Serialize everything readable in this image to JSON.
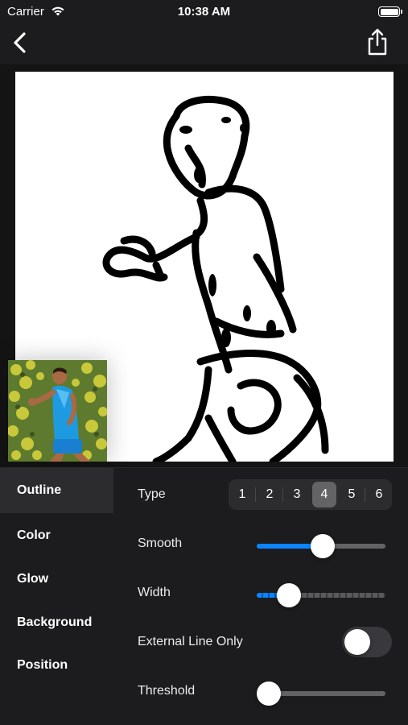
{
  "status_bar": {
    "carrier": "Carrier",
    "time": "10:38 AM"
  },
  "nav": {
    "back_icon": "chevron-left-icon",
    "share_icon": "share-icon"
  },
  "preview": {
    "image": "outline-sketch-of-runner",
    "thumbnail": "original-runner-photo"
  },
  "menu": {
    "items": [
      {
        "label": "Outline",
        "active": true
      },
      {
        "label": "Color",
        "active": false
      },
      {
        "label": "Glow",
        "active": false
      },
      {
        "label": "Background",
        "active": false
      },
      {
        "label": "Position",
        "active": false
      }
    ]
  },
  "controls": {
    "type": {
      "label": "Type",
      "options": [
        "1",
        "2",
        "3",
        "4",
        "5",
        "6"
      ],
      "selected": "4"
    },
    "smooth": {
      "label": "Smooth",
      "value": 0.51
    },
    "width": {
      "label": "Width",
      "value": 0.25
    },
    "external_line_only": {
      "label": "External Line Only",
      "on": false
    },
    "threshold": {
      "label": "Threshold",
      "value": 0.04
    }
  },
  "colors": {
    "accent": "#0a84ff",
    "background": "#1c1c1e",
    "selected_segment": "#636366"
  }
}
